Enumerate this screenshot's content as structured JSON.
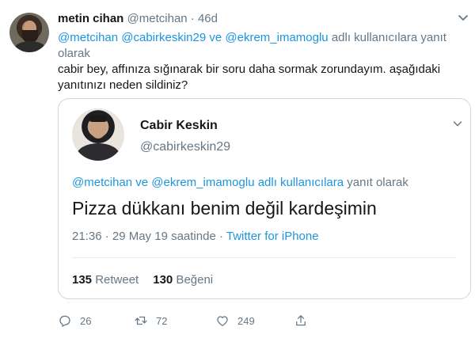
{
  "author": {
    "name": "metin cihan",
    "handle": "@metcihan",
    "dot": "·",
    "time": "46d"
  },
  "reply_to": {
    "mentions": "@metcihan @cabirkeskin29 ve @ekrem_imamoglu",
    "suffix": " adlı kullanıcılara yanıt olarak"
  },
  "tweet_text": "cabir bey, affınıza sığınarak bir soru daha sormak zorundayım. aşağıdaki yanıtınızı neden sildiniz?",
  "quoted": {
    "name": "Cabir Keskin",
    "handle": "@cabirkeskin29",
    "reply_mentions": "@metcihan ve @ekrem_imamoglu adlı kullanıcılara",
    "reply_suffix": " yanıt olarak",
    "text": "Pizza dükkanı benim değil kardeşimin",
    "time": "21:36 · 29 May 19 saatinde · ",
    "source": "Twitter for iPhone",
    "retweet_count": "135",
    "retweet_label": " Retweet",
    "like_count": "130",
    "like_label": " Beğeni"
  },
  "actions": {
    "reply_count": "26",
    "retweet_count": "72",
    "like_count": "249"
  },
  "colors": {
    "link": "#1b95e0",
    "muted": "#657786",
    "text": "#14171a",
    "border": "#ccd6dd"
  },
  "icons": [
    "caret-down-icon",
    "reply-icon",
    "retweet-icon",
    "like-icon",
    "share-icon"
  ]
}
